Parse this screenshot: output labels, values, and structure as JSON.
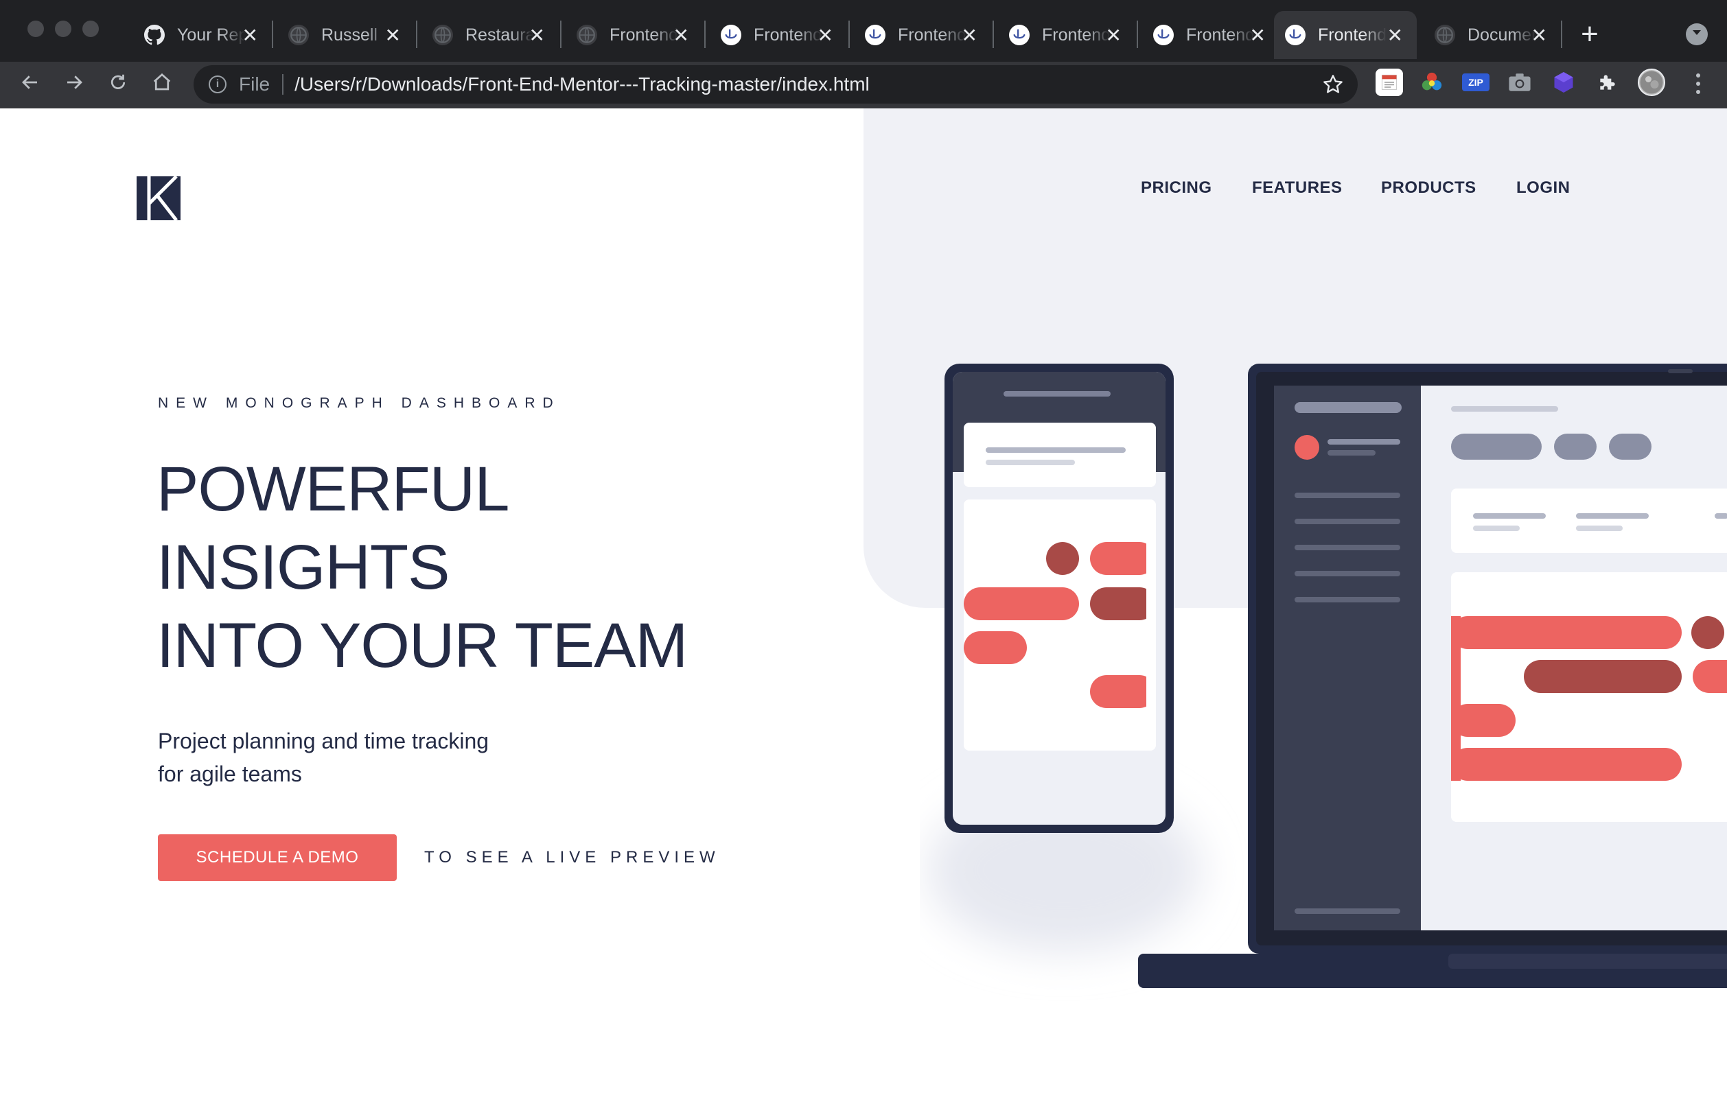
{
  "browser": {
    "tabs": [
      {
        "title": "Your Repositories",
        "icon": "github-icon",
        "active": false
      },
      {
        "title": "Russell",
        "icon": "globe-icon",
        "active": false
      },
      {
        "title": "Restaurant",
        "icon": "globe-icon",
        "active": false
      },
      {
        "title": "Frontend Mentor",
        "icon": "globe-icon",
        "active": false
      },
      {
        "title": "Frontend Mentor",
        "icon": "frontend-mentor-icon",
        "active": false
      },
      {
        "title": "Frontend Mentor",
        "icon": "frontend-mentor-icon",
        "active": false
      },
      {
        "title": "Frontend Mentor",
        "icon": "frontend-mentor-icon",
        "active": false
      },
      {
        "title": "Frontend Mentor",
        "icon": "frontend-mentor-icon",
        "active": false
      },
      {
        "title": "Frontend Mentor",
        "icon": "frontend-mentor-icon",
        "active": true
      },
      {
        "title": "Document",
        "icon": "globe-icon",
        "active": false
      }
    ],
    "close_glyph": "✕",
    "new_tab_glyph": "+",
    "address": {
      "scheme_label": "File",
      "url": "/Users/r/Downloads/Front-End-Mentor---Tracking-master/index.html"
    },
    "extensions": [
      "notes-extension-icon",
      "color-picker-extension-icon",
      "zip-extension-icon",
      "camera-extension-icon",
      "hexagon-extension-icon",
      "puzzle-extensions-icon"
    ],
    "zip_label": "ZIP"
  },
  "page": {
    "nav": [
      "PRICING",
      "FEATURES",
      "PRODUCTS",
      "LOGIN"
    ],
    "eyebrow": "NEW MONOGRAPH DASHBOARD",
    "headline": [
      "POWERFUL",
      "INSIGHTS",
      "INTO YOUR TEAM"
    ],
    "subtitle": [
      "Project planning and time tracking",
      "for agile teams"
    ],
    "cta_label": "SCHEDULE A DEMO",
    "preview_text": "TO SEE A LIVE PREVIEW",
    "colors": {
      "heading": "#242b45",
      "accent": "#ed6461",
      "accent_dark": "#a84a47",
      "panel": "#f0f1f6"
    }
  }
}
